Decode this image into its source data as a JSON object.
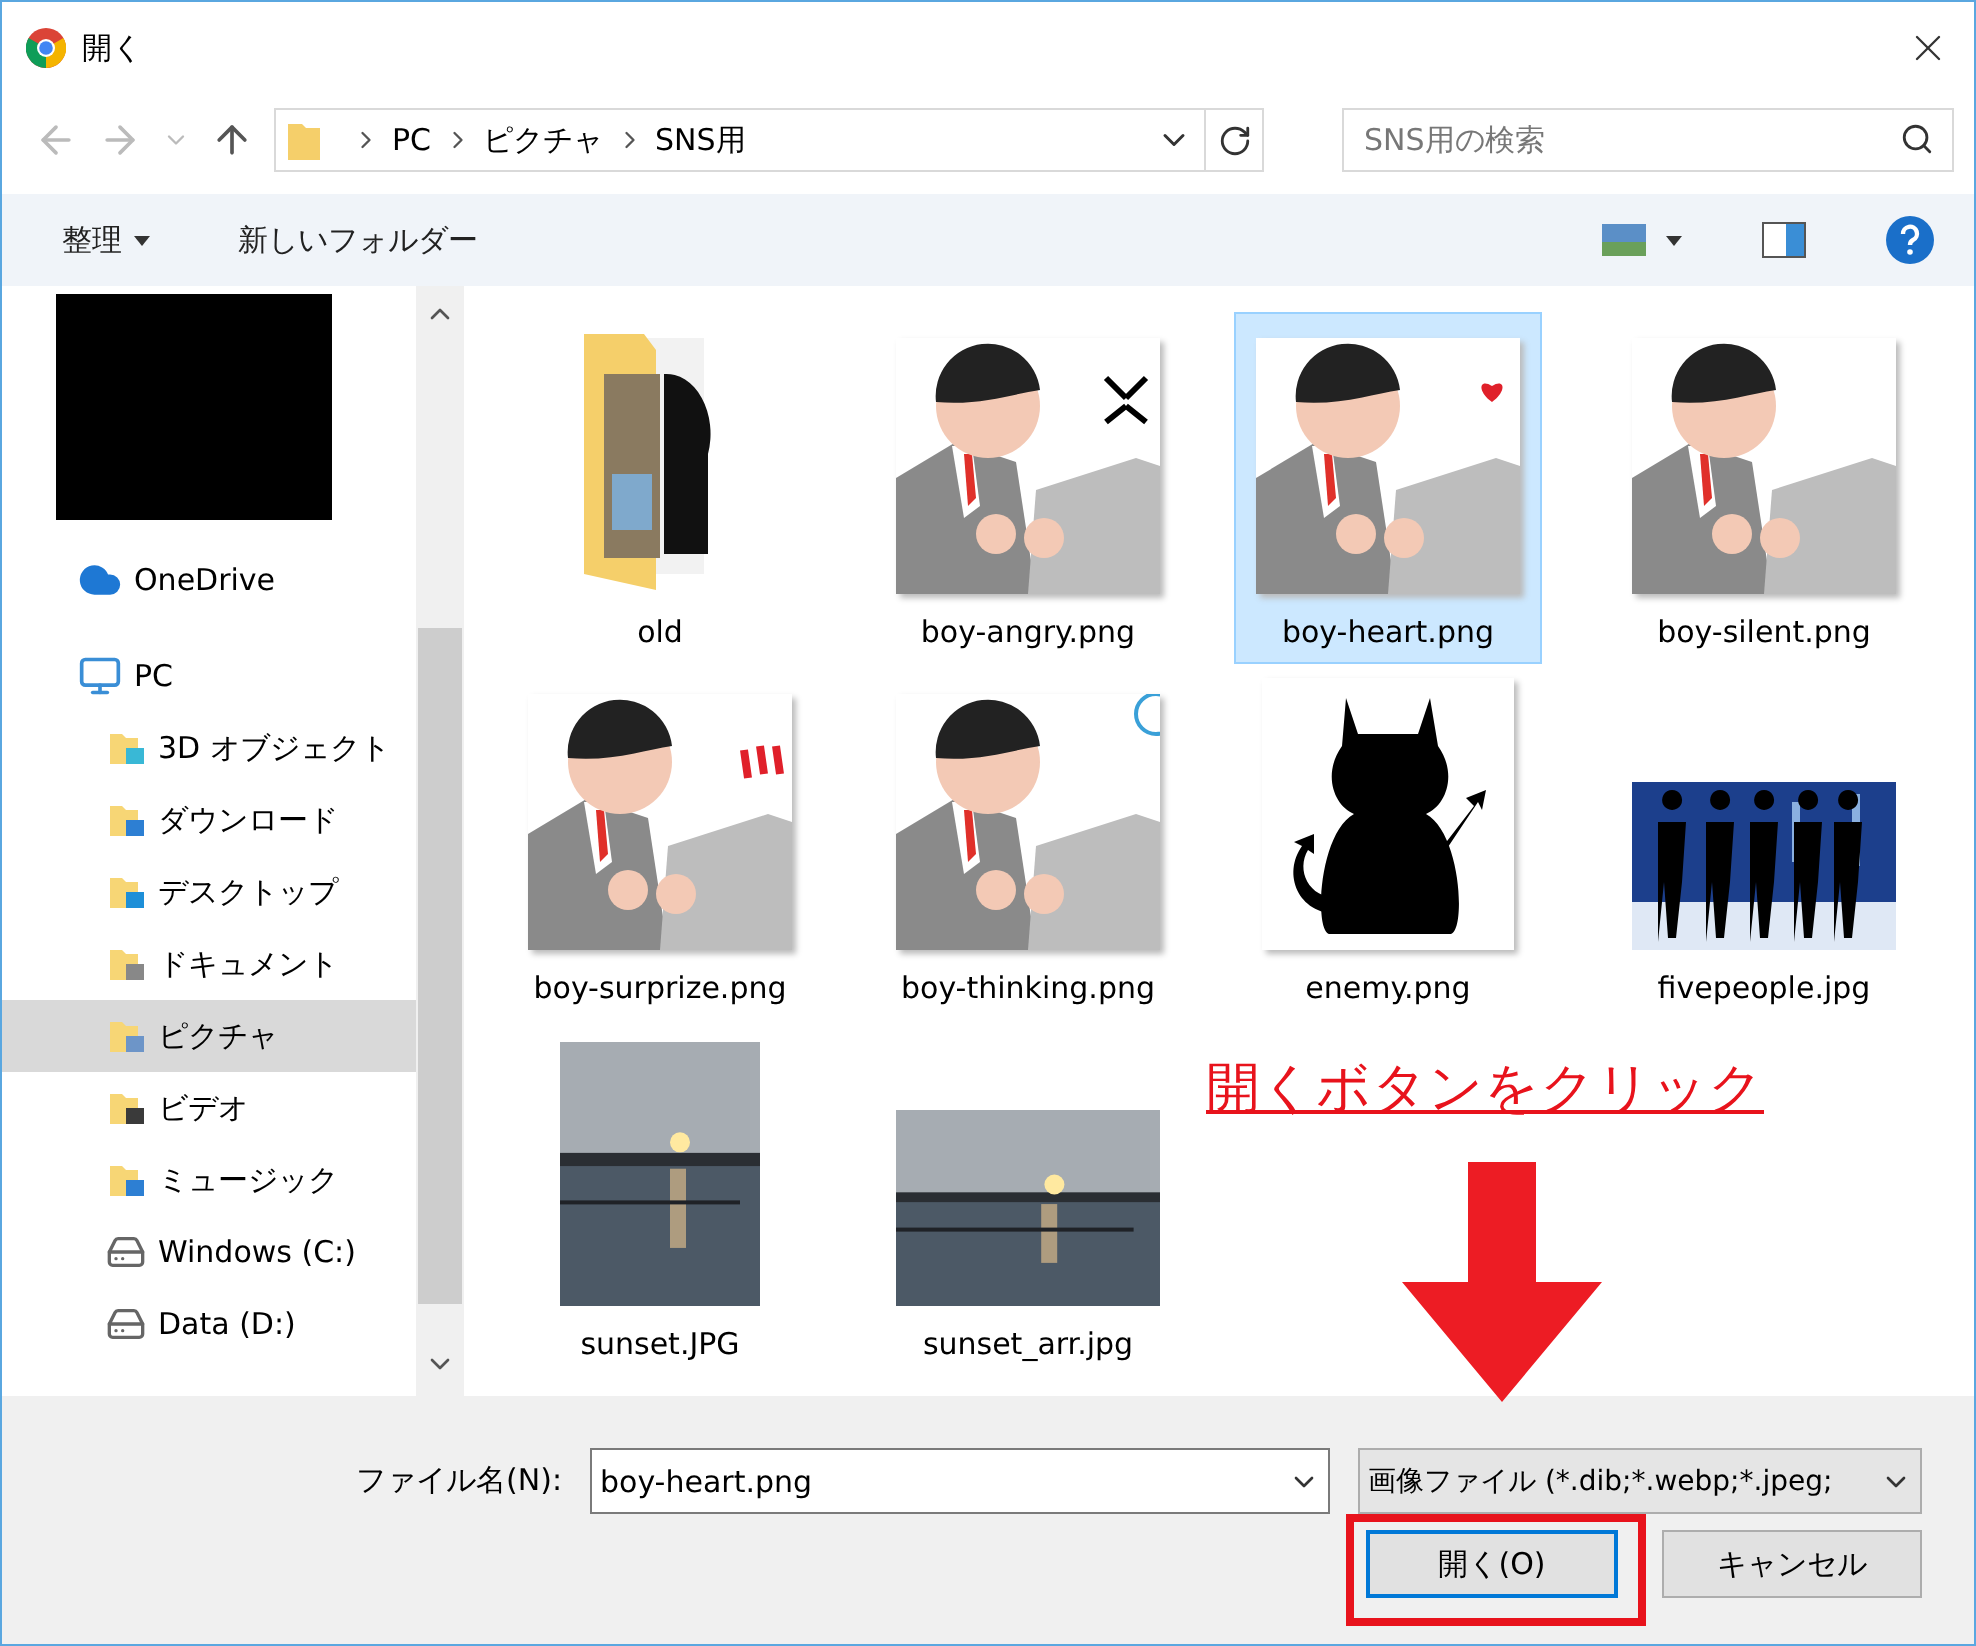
{
  "window": {
    "title": "開く"
  },
  "address": {
    "path": [
      "PC",
      "ピクチャ",
      "SNS用"
    ]
  },
  "search": {
    "placeholder": "SNS用の検索"
  },
  "toolbar": {
    "organize": "整理",
    "new_folder": "新しいフォルダー"
  },
  "sidebar": {
    "items": [
      {
        "label": "OneDrive",
        "kind": "cloud",
        "selected": false
      },
      {
        "label": "PC",
        "kind": "pc",
        "selected": false,
        "children": [
          {
            "label": "3D オブジェクト",
            "kind": "objects",
            "selected": false
          },
          {
            "label": "ダウンロード",
            "kind": "download",
            "selected": false
          },
          {
            "label": "デスクトップ",
            "kind": "desktop",
            "selected": false
          },
          {
            "label": "ドキュメント",
            "kind": "documents",
            "selected": false
          },
          {
            "label": "ピクチャ",
            "kind": "pictures",
            "selected": true
          },
          {
            "label": "ビデオ",
            "kind": "video",
            "selected": false
          },
          {
            "label": "ミュージック",
            "kind": "music",
            "selected": false
          },
          {
            "label": "Windows (C:)",
            "kind": "drive",
            "selected": false
          },
          {
            "label": "Data (D:)",
            "kind": "drive",
            "selected": false
          }
        ]
      }
    ]
  },
  "files": [
    {
      "name": "old",
      "kind": "folder",
      "selected": false
    },
    {
      "name": "boy-angry.png",
      "kind": "boy",
      "selected": false
    },
    {
      "name": "boy-heart.png",
      "kind": "boy",
      "selected": true
    },
    {
      "name": "boy-silent.png",
      "kind": "boy",
      "selected": false
    },
    {
      "name": "boy-surprize.png",
      "kind": "boy",
      "selected": false
    },
    {
      "name": "boy-thinking.png",
      "kind": "boy",
      "selected": false
    },
    {
      "name": "enemy.png",
      "kind": "devil",
      "selected": false
    },
    {
      "name": "fivepeople.jpg",
      "kind": "people",
      "selected": false
    },
    {
      "name": "sunset.JPG",
      "kind": "sunset_tall",
      "selected": false
    },
    {
      "name": "sunset_arr.jpg",
      "kind": "sunset_wide",
      "selected": false
    }
  ],
  "footer": {
    "filename_label": "ファイル名(N):",
    "filename": "boy-heart.png",
    "filter": "画像ファイル (*.dib;*.webp;*.jpeg;",
    "open_button": "開く(O)",
    "cancel_button": "キャンセル"
  },
  "annotation": {
    "text": "開くボタンをクリック"
  }
}
